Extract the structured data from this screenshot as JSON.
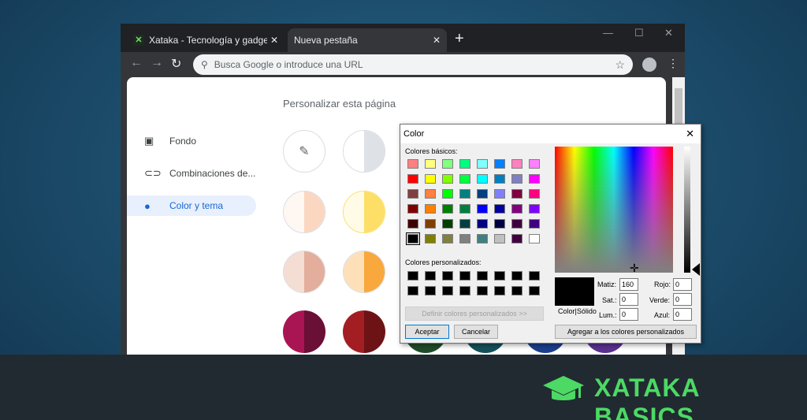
{
  "browser": {
    "tabs": [
      {
        "title": "Xataka - Tecnología y gadgets, m"
      },
      {
        "title": "Nueva pestaña"
      }
    ],
    "omnibox_placeholder": "Busca Google o introduce una URL"
  },
  "page": {
    "title": "Personalizar esta página",
    "sidebar": [
      {
        "label": "Fondo",
        "icon": "image-icon"
      },
      {
        "label": "Combinaciones de...",
        "icon": "link-icon"
      },
      {
        "label": "Color y tema",
        "icon": "palette-icon",
        "selected": true
      }
    ],
    "themes": [
      [
        "#ffffff",
        "#ffffff",
        "#dadce0"
      ],
      [
        "#fff7f2",
        "#fbd7c2"
      ],
      [
        "#fffbe6",
        "#fddf68"
      ],
      [
        "#f4ddd3",
        "#e3ae9b"
      ],
      [
        "#fde0b8",
        "#f9a83d"
      ],
      [
        "#a91552",
        "#6a0f35"
      ],
      [
        "#a31e22",
        "#6d1316"
      ]
    ]
  },
  "dialog": {
    "title": "Color",
    "basic_label": "Colores básicos:",
    "custom_label": "Colores personalizados:",
    "define_button": "Definir colores personalizados >>",
    "ok_button": "Aceptar",
    "cancel_button": "Cancelar",
    "add_button": "Agregar a los colores personalizados",
    "solid_label": "Color|Sólido",
    "fields": {
      "hue_label": "Matiz:",
      "hue": "160",
      "sat_label": "Sat.:",
      "sat": "0",
      "lum_label": "Lum.:",
      "lum": "0",
      "red_label": "Rojo:",
      "red": "0",
      "green_label": "Verde:",
      "green": "0",
      "blue_label": "Azul:",
      "blue": "0"
    },
    "basic_colors": [
      "#ff8080",
      "#ffff80",
      "#80ff80",
      "#00ff80",
      "#80ffff",
      "#0080ff",
      "#ff80c0",
      "#ff80ff",
      "#ff0000",
      "#ffff00",
      "#80ff00",
      "#00ff40",
      "#00ffff",
      "#0080c0",
      "#8080c0",
      "#ff00ff",
      "#804040",
      "#ff8040",
      "#00ff00",
      "#008080",
      "#004080",
      "#8080ff",
      "#800040",
      "#ff0080",
      "#800000",
      "#ff8000",
      "#008000",
      "#008040",
      "#0000ff",
      "#0000a0",
      "#800080",
      "#8000ff",
      "#400000",
      "#804000",
      "#004000",
      "#004040",
      "#000080",
      "#000040",
      "#400040",
      "#400080",
      "#000000",
      "#808000",
      "#808040",
      "#808080",
      "#408080",
      "#c0c0c0",
      "#400040",
      "#ffffff"
    ]
  },
  "banner": {
    "brand": "XATAKA BASICS"
  }
}
